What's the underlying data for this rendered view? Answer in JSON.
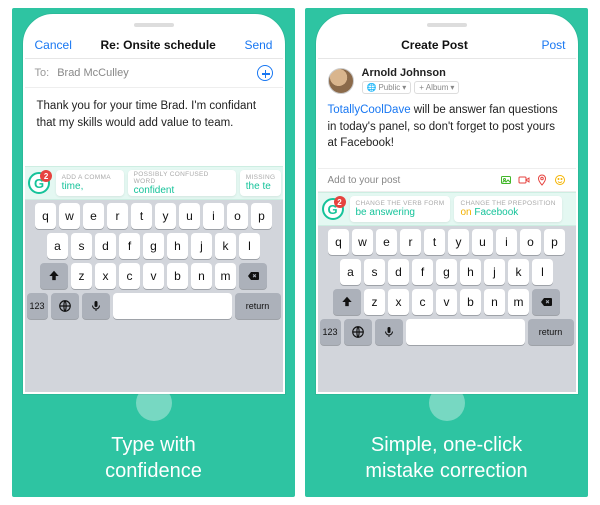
{
  "left": {
    "header": {
      "cancel": "Cancel",
      "title": "Re: Onsite schedule",
      "send": "Send"
    },
    "to": {
      "label": "To:",
      "value": "Brad McCulley"
    },
    "body": "Thank you for your time Brad. I'm confidant that my skills would add value to team.",
    "grammarly": {
      "badge": "2",
      "cards": [
        {
          "label": "ADD A COMMA",
          "value": "time,"
        },
        {
          "label": "POSSIBLY CONFUSED WORD",
          "value": "confident"
        },
        {
          "label": "MISSING",
          "value": "the te"
        }
      ]
    },
    "caption": "Type with\nconfidence"
  },
  "right": {
    "header": {
      "cancel": " ",
      "title": "Create Post",
      "send": "Post"
    },
    "user": {
      "name": "Arnold Johnson",
      "chip1": "Public",
      "chip2": "+ Album"
    },
    "body": {
      "link": "TotallyCoolDave",
      "rest": " will be answer fan questions in today's panel, so don't forget to post yours at Facebook!"
    },
    "addRow": "Add to your post",
    "grammarly": {
      "badge": "2",
      "cards": [
        {
          "label": "CHANGE THE VERB FORM",
          "value": "be answering"
        },
        {
          "label": "CHANGE THE PREPOSITION",
          "pre": "on",
          "value": " Facebook"
        }
      ]
    },
    "caption": "Simple, one-click\nmistake correction"
  },
  "keyboard": {
    "row1": [
      "q",
      "w",
      "e",
      "r",
      "t",
      "y",
      "u",
      "i",
      "o",
      "p"
    ],
    "row2": [
      "a",
      "s",
      "d",
      "f",
      "g",
      "h",
      "j",
      "k",
      "l"
    ],
    "row3": [
      "z",
      "x",
      "c",
      "v",
      "b",
      "n",
      "m"
    ],
    "numKey": "123",
    "returnKey": "return"
  }
}
